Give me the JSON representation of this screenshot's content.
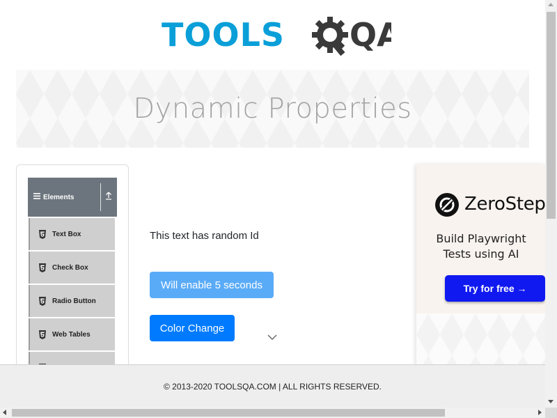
{
  "logo": {
    "text_primary": "TOOLS",
    "text_secondary": "QA",
    "primary_color": "#0a9fd8",
    "secondary_color": "#3a3a3a"
  },
  "banner": {
    "title": "Dynamic Properties"
  },
  "sidebar": {
    "group_label": "Elements",
    "items": [
      {
        "label": "Text Box",
        "icon": "html5-icon"
      },
      {
        "label": "Check Box",
        "icon": "html5-icon"
      },
      {
        "label": "Radio Button",
        "icon": "html5-icon"
      },
      {
        "label": "Web Tables",
        "icon": "html5-icon"
      },
      {
        "label": "",
        "icon": "html5-icon"
      }
    ]
  },
  "main": {
    "random_id_text": "This text has random Id",
    "enable_button_label": "Will enable 5 seconds",
    "color_change_button_label": "Color Change"
  },
  "ad": {
    "brand": "ZeroStep",
    "tagline_line1": "Build Playwright",
    "tagline_line2": "Tests using AI",
    "cta_label": "Try for free →"
  },
  "footer": {
    "text": "© 2013-2020 TOOLSQA.COM | ALL RIGHTS RESERVED."
  },
  "colors": {
    "primary_button": "#007bff",
    "disabled_button": "#5aabf7",
    "sidebar_header": "#6c757d",
    "ad_cta": "#1019f0"
  }
}
